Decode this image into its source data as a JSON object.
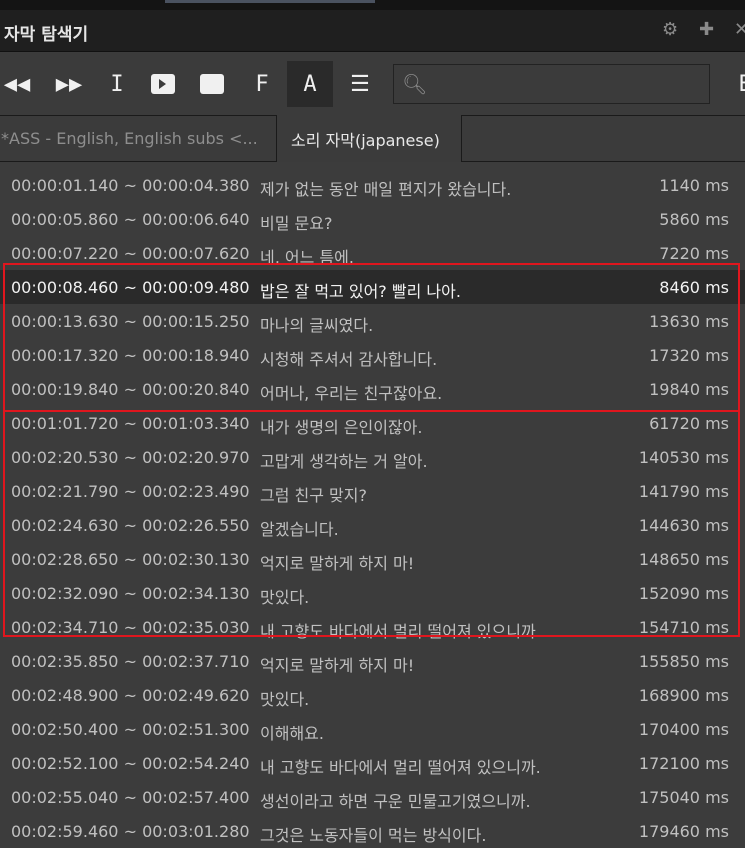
{
  "window": {
    "title": "자막 탐색기"
  },
  "toolbar": {
    "buttons": [
      "prev-icon",
      "next-icon",
      "text-cursor-icon",
      "play-icon",
      "stop-icon",
      "F",
      "A",
      "menu-icon"
    ],
    "f_label": "F",
    "a_label": "A",
    "e_label": "E",
    "search_placeholder": ""
  },
  "tabs": [
    {
      "label": "*ASS - English, English subs <..."
    },
    {
      "label": "소리 자막(japanese)"
    }
  ],
  "colors": {
    "highlight": "#e0161e",
    "selected_row": "#2a2a2a"
  },
  "rows": [
    {
      "time": "00:00:01.140 ~ 00:00:04.380",
      "text": "제가 없는 동안 매일 편지가 왔습니다.",
      "ms": "1140 ms"
    },
    {
      "time": "00:00:05.860 ~ 00:00:06.640",
      "text": "비밀 문요?",
      "ms": "5860 ms"
    },
    {
      "time": "00:00:07.220 ~ 00:00:07.620",
      "text": "네, 어느 틈에.",
      "ms": "7220 ms"
    },
    {
      "time": "00:00:08.460 ~ 00:00:09.480",
      "text": "밥은 잘 먹고 있어? 빨리 나아.",
      "ms": "8460 ms"
    },
    {
      "time": "00:00:13.630 ~ 00:00:15.250",
      "text": "마나의 글씨였다.",
      "ms": "13630 ms"
    },
    {
      "time": "00:00:17.320 ~ 00:00:18.940",
      "text": "시청해 주셔서 감사합니다.",
      "ms": "17320 ms"
    },
    {
      "time": "00:00:19.840 ~ 00:00:20.840",
      "text": "어머나, 우리는 친구잖아요.",
      "ms": "19840 ms"
    },
    {
      "time": "00:01:01.720 ~ 00:01:03.340",
      "text": "내가 생명의 은인이잖아.",
      "ms": "61720 ms"
    },
    {
      "time": "00:02:20.530 ~ 00:02:20.970",
      "text": "고맙게 생각하는 거 알아.",
      "ms": "140530 ms"
    },
    {
      "time": "00:02:21.790 ~ 00:02:23.490",
      "text": "그럼 친구 맞지?",
      "ms": "141790 ms"
    },
    {
      "time": "00:02:24.630 ~ 00:02:26.550",
      "text": "알겠습니다.",
      "ms": "144630 ms"
    },
    {
      "time": "00:02:28.650 ~ 00:02:30.130",
      "text": "억지로 말하게 하지 마!",
      "ms": "148650 ms"
    },
    {
      "time": "00:02:32.090 ~ 00:02:34.130",
      "text": "맛있다.",
      "ms": "152090 ms"
    },
    {
      "time": "00:02:34.710 ~ 00:02:35.030",
      "text": "내 고향도 바다에서 멀리 떨어져 있으니까.",
      "ms": "154710 ms"
    },
    {
      "time": "00:02:35.850 ~ 00:02:37.710",
      "text": "억지로 말하게 하지 마!",
      "ms": "155850 ms"
    },
    {
      "time": "00:02:48.900 ~ 00:02:49.620",
      "text": "맛있다.",
      "ms": "168900 ms"
    },
    {
      "time": "00:02:50.400 ~ 00:02:51.300",
      "text": "이해해요.",
      "ms": "170400 ms"
    },
    {
      "time": "00:02:52.100 ~ 00:02:54.240",
      "text": "내 고향도 바다에서 멀리 떨어져 있으니까.",
      "ms": "172100 ms"
    },
    {
      "time": "00:02:55.040 ~ 00:02:57.400",
      "text": "생선이라고 하면 구운 민물고기였으니까.",
      "ms": "175040 ms"
    },
    {
      "time": "00:02:59.460 ~ 00:03:01.280",
      "text": "그것은 노동자들이 먹는 방식이다.",
      "ms": "179460 ms"
    }
  ],
  "selected_index": 3
}
